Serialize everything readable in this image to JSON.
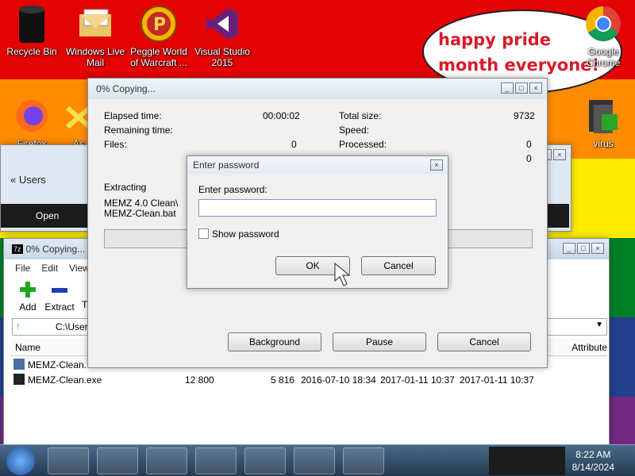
{
  "desktop": {
    "speech": "happy pride month everyone!",
    "icons": [
      {
        "label": "Recycle Bin"
      },
      {
        "label": "Windows Live Mail"
      },
      {
        "label": "Peggle World of Warcraft ..."
      },
      {
        "label": "Visual Studio 2015"
      },
      {
        "label": "Google Chrome"
      },
      {
        "label": "Firefox"
      },
      {
        "label": "As"
      },
      {
        "label": "virus"
      }
    ]
  },
  "explorer_bg": {
    "crumb_users": "Users"
  },
  "sevenzip": {
    "title": "0% Copying...",
    "menu": [
      "File",
      "Edit",
      "View"
    ],
    "toolbar": [
      "Add",
      "Extract",
      "T"
    ],
    "open_label": "Open",
    "path": "C:\\Users\\",
    "columns": {
      "name": "Name",
      "attributes": "Attribute"
    },
    "rows": [
      {
        "name": "MEMZ-Clean...",
        "size": "",
        "packed": "",
        "modified": "",
        "created": ""
      },
      {
        "name": "MEMZ-Clean.exe",
        "size": "12 800",
        "packed": "5 816",
        "modified": "2016-07-10 18:34",
        "created": "2017-01-11 10:37",
        "accessed": "2017-01-11 10:37"
      }
    ]
  },
  "progress": {
    "title": "0% Copying...",
    "elapsed_label": "Elapsed time:",
    "elapsed_value": "00:00:02",
    "remaining_label": "Remaining time:",
    "files_label": "Files:",
    "files_value": "0",
    "total_label": "Total size:",
    "total_value": "9732",
    "speed_label": "Speed:",
    "processed_label": "Processed:",
    "processed_value": "0",
    "extra_value": "0",
    "extracting_label": "Extracting",
    "extracting_path": "MEMZ 4.0 Clean\\",
    "extracting_file": "MEMZ-Clean.bat",
    "background_button": "Background",
    "pause_button": "Pause",
    "cancel_button": "Cancel"
  },
  "password_dialog": {
    "title": "Enter password",
    "prompt": "Enter password:",
    "value": "",
    "show_password": "Show password",
    "ok": "OK",
    "cancel": "Cancel"
  },
  "taskbar": {
    "time": "8:22 AM",
    "date": "8/14/2024"
  }
}
